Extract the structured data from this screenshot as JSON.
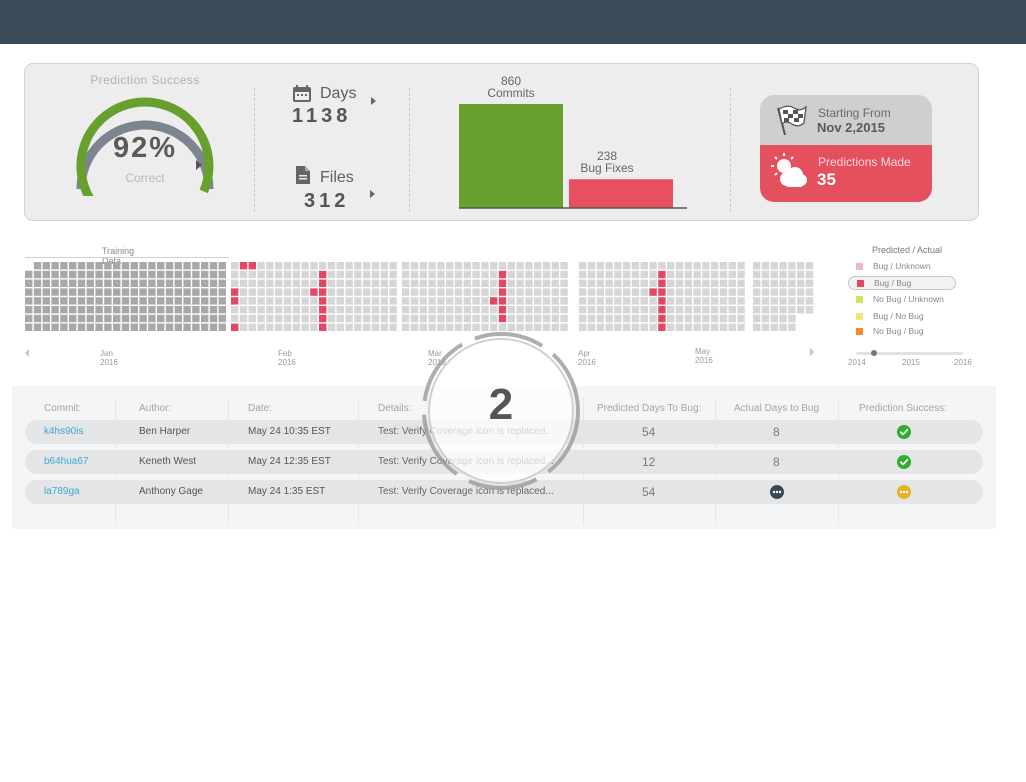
{
  "summary": {
    "gauge": {
      "title": "Prediction Success",
      "value": "92%",
      "sub": "Correct",
      "percent": 92
    },
    "days": {
      "label": "Days",
      "value": "1138",
      "icon": "calendar-icon"
    },
    "files": {
      "label": "Files",
      "value": "312",
      "icon": "file-icon"
    },
    "bars": [
      {
        "value": "860",
        "label": "Commits",
        "amount": 860,
        "color": "#67a02c"
      },
      {
        "value": "238",
        "label": "Bug Fixes",
        "amount": 238,
        "color": "#e9505f"
      }
    ],
    "card": {
      "start_label": "Starting From",
      "start_date": "Nov 2,2015",
      "pred_label": "Predictions Made",
      "pred_value": "35",
      "flag_icon": "checkered-flag-icon",
      "weather_icon": "sun-cloud-icon"
    }
  },
  "timeline": {
    "training_label": "Training Data",
    "months": [
      "Jan 2016",
      "Feb 2016",
      "Mar 2016",
      "Apr 2016",
      "May 2016"
    ]
  },
  "legend": {
    "title": "Predicted / Actual",
    "items": [
      {
        "label": "Bug  /  Unknown",
        "color": "#f2b8c1"
      },
      {
        "label": "Bug  /  Bug",
        "color": "#e44761"
      },
      {
        "label": "No Bug / Unknown",
        "color": "#cfe26c"
      },
      {
        "label": "Bug  /  No Bug",
        "color": "#f4e27a"
      },
      {
        "label": "No Bug / Bug",
        "color": "#f6892c"
      }
    ],
    "years": [
      "2014",
      "2015",
      "2016"
    ]
  },
  "table": {
    "headers": [
      "Commit:",
      "Author:",
      "Date:",
      "Details:",
      "Predicted Days To Bug:",
      "Actual Days to Bug",
      "Prediction Success:"
    ],
    "rows": [
      {
        "commit": "k4hs90is",
        "author": "Ben Harper",
        "date": "May 24 10:35 EST",
        "details": "Test: Verify Coverage icon is replaced...",
        "predicted": "54",
        "actual": "8",
        "actual_pending": false,
        "success": "check"
      },
      {
        "commit": "b64hua67",
        "author": "Keneth West",
        "date": "May 24 12:35 EST",
        "details": "Test: Verify Coverage icon is replaced...",
        "predicted": "12",
        "actual": "8",
        "actual_pending": false,
        "success": "check"
      },
      {
        "commit": "la789ga",
        "author": "Anthony Gage",
        "date": "May 24 1:35 EST",
        "details": "Test: Verify Coverage icon is replaced...",
        "predicted": "54",
        "actual": "",
        "actual_pending": true,
        "success": "pending"
      }
    ]
  },
  "overlay": {
    "step": "2"
  },
  "colors": {
    "topbar": "#3b4a59",
    "green": "#67a02c",
    "red": "#e9505f",
    "link": "#3fa9d3",
    "success": "#2eae2e",
    "pending_dark": "#3c4754",
    "pending_yellow": "#e8b12a"
  }
}
